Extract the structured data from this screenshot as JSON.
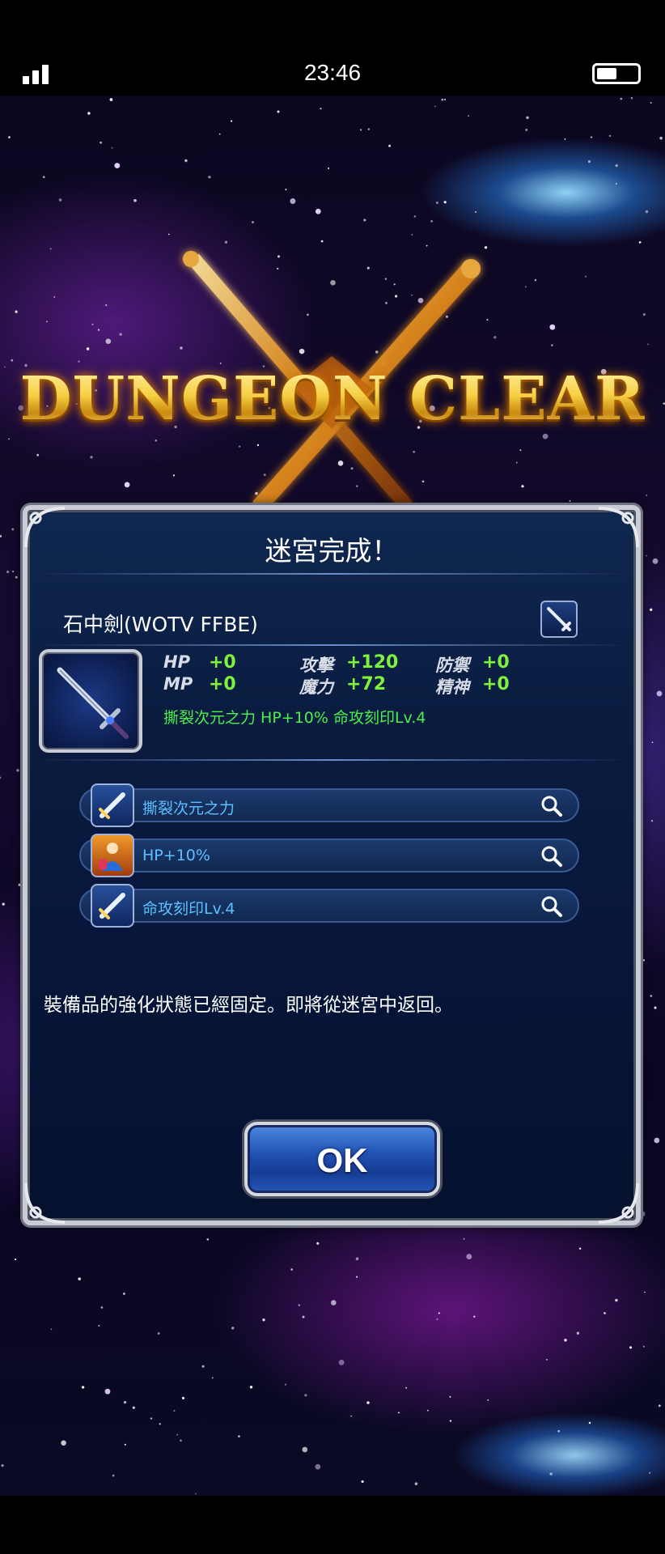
{
  "status_bar": {
    "time": "23:46",
    "icons": [
      "signal-icon",
      "battery-icon"
    ]
  },
  "banner": {
    "title": "DUNGEON CLEAR"
  },
  "dialog": {
    "title": "迷宮完成！",
    "item": {
      "name": "石中劍(WOTV FFBE)",
      "type_icon": "sword-type-icon",
      "image_icon": "sword-icon",
      "stats": [
        {
          "label": "HP",
          "value": "+0"
        },
        {
          "label": "攻擊",
          "value": "+120"
        },
        {
          "label": "防禦",
          "value": "+0"
        },
        {
          "label": "MP",
          "value": "+0"
        },
        {
          "label": "魔力",
          "value": "+72"
        },
        {
          "label": "精神",
          "value": "+0"
        }
      ],
      "passives": "撕裂次元之力 HP+10% 命攻刻印Lv.4"
    },
    "abilities": [
      {
        "label": "撕裂次元之力",
        "icon": "sword-ability-icon"
      },
      {
        "label": "HP+10%",
        "icon": "hp-ability-icon"
      },
      {
        "label": "命攻刻印Lv.4",
        "icon": "sword-ability-icon"
      }
    ],
    "message": "裝備品的強化狀態已經固定。即將從迷宮中返回。",
    "ok_label": "OK"
  },
  "colors": {
    "stat_value": "#7ef23c",
    "passive_text": "#4cf04a",
    "ability_text": "#5cc0ff",
    "title_gold": "#f5c842",
    "dialog_bg": "#0a1c40"
  }
}
